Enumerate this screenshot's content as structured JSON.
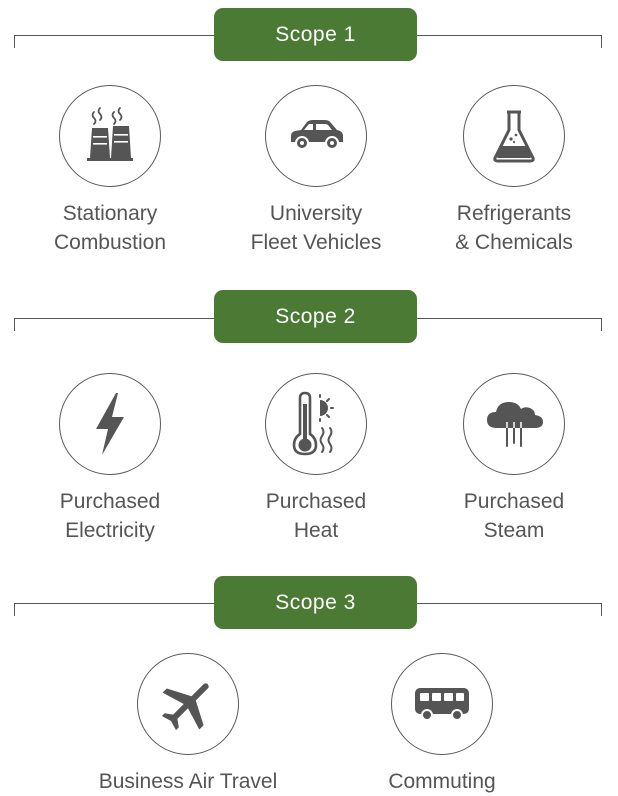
{
  "scopes": [
    {
      "title": "Scope 1",
      "items": [
        {
          "icon": "factory-icon",
          "line1": "Stationary",
          "line2": "Combustion"
        },
        {
          "icon": "car-icon",
          "line1": "University",
          "line2": "Fleet Vehicles"
        },
        {
          "icon": "flask-icon",
          "line1": "Refrigerants",
          "line2": "& Chemicals"
        }
      ]
    },
    {
      "title": "Scope 2",
      "items": [
        {
          "icon": "lightning-icon",
          "line1": "Purchased",
          "line2": "Electricity"
        },
        {
          "icon": "thermometer-icon",
          "line1": "Purchased",
          "line2": "Heat"
        },
        {
          "icon": "steam-cloud-icon",
          "line1": "Purchased",
          "line2": "Steam"
        }
      ]
    },
    {
      "title": "Scope 3",
      "items": [
        {
          "icon": "airplane-icon",
          "line1": "Business Air Travel"
        },
        {
          "icon": "bus-icon",
          "line1": "Commuting"
        }
      ]
    }
  ],
  "colors": {
    "pill": "#4a7a34",
    "icon": "#555555",
    "text": "#555555"
  }
}
